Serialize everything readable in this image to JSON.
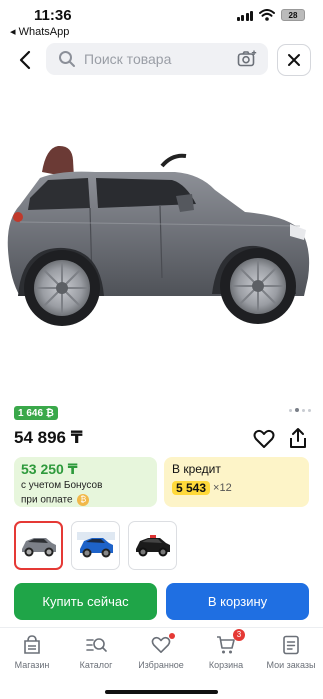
{
  "status_bar": {
    "time": "11:36",
    "back_app": "◂ WhatsApp",
    "battery": "28"
  },
  "search": {
    "placeholder": "Поиск товара"
  },
  "product": {
    "bonus_badge": "1 646 ₿",
    "price": "54 896 ₸",
    "image_pages": 4,
    "active_image": 2
  },
  "bonus_card": {
    "amount": "53 250 ₸",
    "line1": "с учетом Бонусов",
    "line2": "при оплате",
    "coin": "₿"
  },
  "credit_card": {
    "label": "В кредит",
    "monthly": "5 543",
    "months": "×12"
  },
  "thumbnails": [
    {
      "name": "grey-car",
      "color": "#7c8088"
    },
    {
      "name": "blue-car",
      "color": "#1e63c9"
    },
    {
      "name": "black-car",
      "color": "#1b1b1b"
    }
  ],
  "actions": {
    "buy_now": "Купить сейчас",
    "add_to_cart": "В корзину"
  },
  "tabbar": {
    "items": [
      {
        "label": "Магазин",
        "icon": "store-icon"
      },
      {
        "label": "Каталог",
        "icon": "catalog-search-icon"
      },
      {
        "label": "Избранное",
        "icon": "heart-icon"
      },
      {
        "label": "Корзина",
        "icon": "cart-icon",
        "badge": "3"
      },
      {
        "label": "Мои заказы",
        "icon": "orders-icon"
      }
    ]
  },
  "colors": {
    "green_button": "#1fa548",
    "blue_button": "#1f6fe2",
    "bonus_green": "#2e9a3c",
    "credit_yellow": "#ffd93a",
    "badge_red": "#e53935"
  }
}
